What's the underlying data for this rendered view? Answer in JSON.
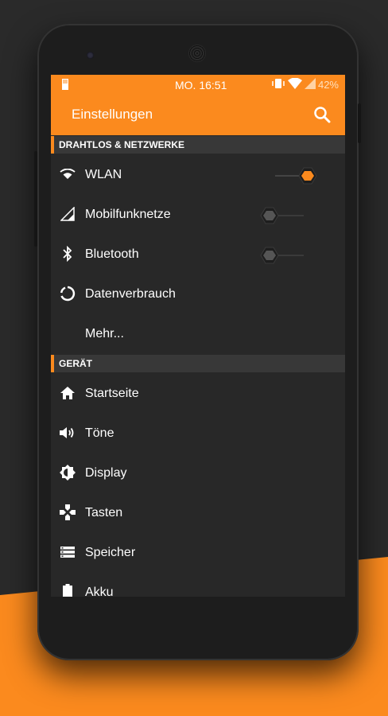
{
  "colors": {
    "accent": "#fb8a1e",
    "screen_bg": "#282828",
    "section_bg": "#383838"
  },
  "statusbar": {
    "time": "MO. 16:51",
    "battery": "42%",
    "icons": [
      "sd-card-icon",
      "vibrate-icon",
      "wifi-icon",
      "signal-icon"
    ]
  },
  "toolbar": {
    "title": "Einstellungen",
    "search_icon": "search-icon"
  },
  "sections": [
    {
      "title": "DRAHTLOS & NETZWERKE",
      "items": [
        {
          "label": "WLAN",
          "icon": "wifi-icon",
          "toggle": true
        },
        {
          "label": "Mobilfunknetze",
          "icon": "signal-icon",
          "toggle": false
        },
        {
          "label": "Bluetooth",
          "icon": "bluetooth-icon",
          "toggle": false
        },
        {
          "label": "Datenverbrauch",
          "icon": "data-usage-icon"
        },
        {
          "label": "Mehr..."
        }
      ]
    },
    {
      "title": "GERÄT",
      "items": [
        {
          "label": "Startseite",
          "icon": "home-icon"
        },
        {
          "label": "Töne",
          "icon": "volume-icon"
        },
        {
          "label": "Display",
          "icon": "brightness-icon"
        },
        {
          "label": "Tasten",
          "icon": "gamepad-icon"
        },
        {
          "label": "Speicher",
          "icon": "storage-icon"
        },
        {
          "label": "Akku",
          "icon": "battery-icon"
        }
      ]
    }
  ]
}
